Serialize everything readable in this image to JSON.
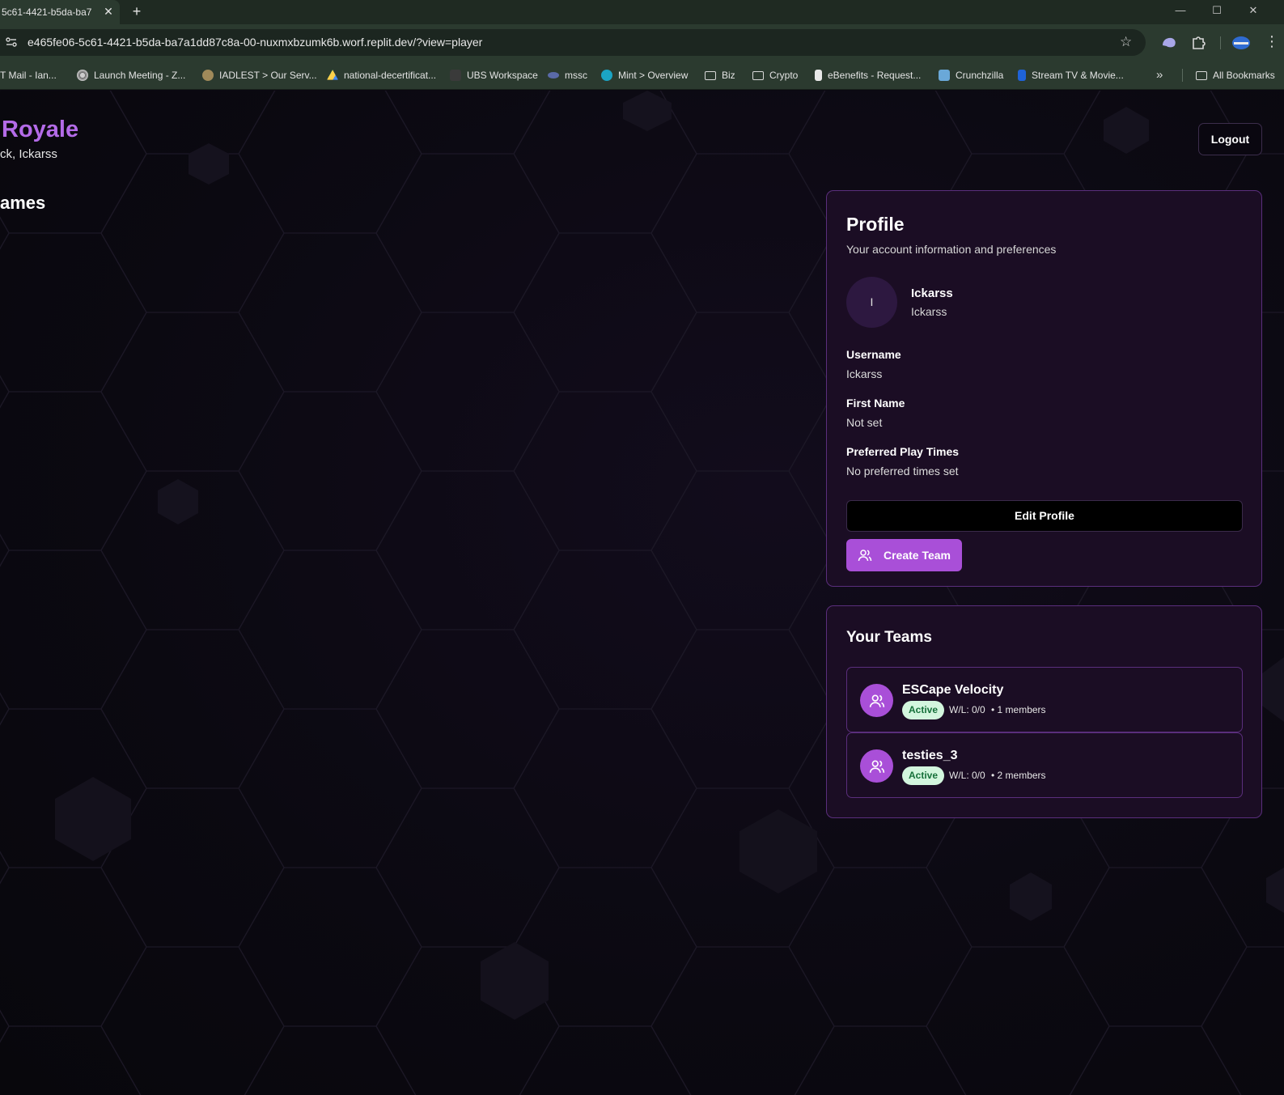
{
  "browser": {
    "tab_title": "5c61-4421-b5da-ba7",
    "tab_close": "✕",
    "new_tab": "+",
    "url": "e465fe06-5c61-4421-b5da-ba7a1dd87c8a-00-nuxmxbzumk6b.worf.replit.dev/?view=player",
    "bookmarks": [
      {
        "label": "T Mail - Ian...",
        "icon": "mail-icon"
      },
      {
        "label": "Launch Meeting - Z...",
        "icon": "globe-icon"
      },
      {
        "label": "IADLEST > Our Serv...",
        "icon": "badge-icon"
      },
      {
        "label": "national-decertificat...",
        "icon": "drive-icon"
      },
      {
        "label": "UBS Workspace",
        "icon": "ubs-icon"
      },
      {
        "label": "mssc",
        "icon": "mssc-icon"
      },
      {
        "label": "Mint > Overview",
        "icon": "mint-icon"
      },
      {
        "label": "Biz",
        "icon": "folder-icon"
      },
      {
        "label": "Crypto",
        "icon": "folder-icon"
      },
      {
        "label": "eBenefits - Request...",
        "icon": "doc-icon"
      },
      {
        "label": "Crunchzilla",
        "icon": "crunchzilla-icon"
      },
      {
        "label": "Stream TV & Movie...",
        "icon": "stream-icon"
      }
    ],
    "all_bookmarks": "All Bookmarks",
    "overflow_glyph": "»"
  },
  "header": {
    "app_title": "Royale",
    "welcome": "ck, Ickarss",
    "logout": "Logout"
  },
  "main": {
    "games_heading": "ames"
  },
  "profile": {
    "title": "Profile",
    "description": "Your account information and preferences",
    "avatar_initial": "I",
    "display_name": "Ickarss",
    "username_sub": "Ickarss",
    "fields": {
      "username_label": "Username",
      "username_value": "Ickarss",
      "first_name_label": "First Name",
      "first_name_value": "Not set",
      "play_times_label": "Preferred Play Times",
      "play_times_value": "No preferred times set"
    },
    "edit_button": "Edit Profile",
    "create_team_button": "Create Team"
  },
  "teams": {
    "title": "Your Teams",
    "items": [
      {
        "name": "ESCape Velocity",
        "status": "Active",
        "record": "W/L: 0/0",
        "members": "• 1 members"
      },
      {
        "name": "testies_3",
        "status": "Active",
        "record": "W/L: 0/0",
        "members": "• 2 members"
      }
    ]
  },
  "colors": {
    "accent": "#a94fd8",
    "title_purple": "#b46be8",
    "card_bg": "#1b0d24",
    "card_border": "#5a2e7c",
    "active_badge_bg": "#d3f6de",
    "active_badge_text": "#16703a",
    "chrome_green": "#2b3a2f"
  }
}
